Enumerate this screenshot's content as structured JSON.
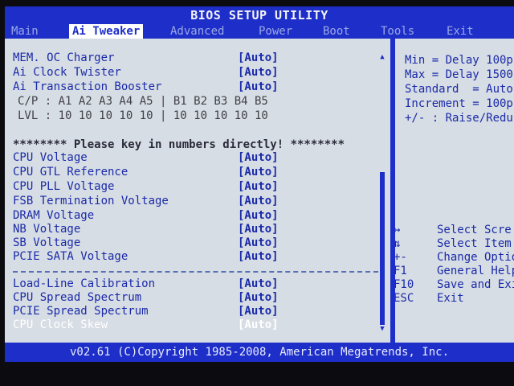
{
  "header": {
    "title": "BIOS SETUP UTILITY",
    "tabs": [
      {
        "label": "Main"
      },
      {
        "label": "Ai Tweaker"
      },
      {
        "label": "Advanced"
      },
      {
        "label": "Power"
      },
      {
        "label": "Boot"
      },
      {
        "label": "Tools"
      },
      {
        "label": "Exit"
      }
    ]
  },
  "settings_top": [
    {
      "label": "MEM. OC Charger",
      "value": "[Auto]"
    },
    {
      "label": "Ai Clock Twister",
      "value": "[Auto]"
    },
    {
      "label": "Ai Transaction Booster",
      "value": "[Auto]"
    }
  ],
  "cp_row": "C/P : A1 A2 A3 A4 A5 | B1 B2 B3 B4 B5",
  "lvl_row": "LVL : 10 10 10 10 10 | 10 10 10 10 10",
  "notice": "******** Please key in numbers directly! ********",
  "settings_voltage": [
    {
      "label": "CPU Voltage",
      "value": "[Auto]"
    },
    {
      "label": "CPU GTL Reference",
      "value": "[Auto]"
    },
    {
      "label": "CPU PLL Voltage",
      "value": "[Auto]"
    },
    {
      "label": "FSB Termination Voltage",
      "value": "[Auto]"
    },
    {
      "label": "DRAM Voltage",
      "value": "[Auto]"
    },
    {
      "label": "NB Voltage",
      "value": "[Auto]"
    },
    {
      "label": "SB Voltage",
      "value": "[Auto]"
    },
    {
      "label": "PCIE SATA Voltage",
      "value": "[Auto]"
    }
  ],
  "settings_bottom": [
    {
      "label": "Load-Line Calibration",
      "value": "[Auto]"
    },
    {
      "label": "CPU Spread Spectrum",
      "value": "[Auto]"
    },
    {
      "label": "PCIE Spread Spectrum",
      "value": "[Auto]"
    },
    {
      "label": "CPU Clock Skew",
      "value": "[Auto]"
    }
  ],
  "help": [
    "Min = Delay 100p",
    "Max = Delay 1500",
    "Standard  = Auto",
    "Increment = 100p",
    "+/- : Raise/Redu"
  ],
  "keys": [
    {
      "key": "↔",
      "desc": "Select Scre"
    },
    {
      "key": "⇅",
      "desc": "Select Item"
    },
    {
      "key": "+-",
      "desc": "Change Optio"
    },
    {
      "key": "F1",
      "desc": "General Help"
    },
    {
      "key": "F10",
      "desc": "Save and Exi"
    },
    {
      "key": "ESC",
      "desc": "Exit"
    }
  ],
  "footer": "v02.61 (C)Copyright 1985-2008, American Megatrends, Inc.",
  "colors": {
    "bios_blue": "#1e2ec8",
    "panel_gray": "#d7dde4",
    "text_blue": "#1a2aa8",
    "highlight_white": "#ffffff"
  }
}
